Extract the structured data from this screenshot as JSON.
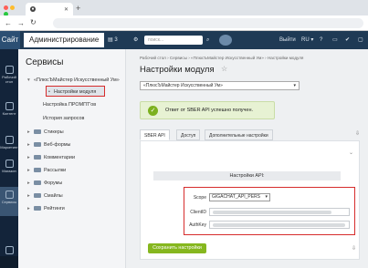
{
  "browser": {
    "tab_title": "",
    "traffic_colors": [
      "#ff5f57",
      "#febc2e",
      "#28c840"
    ]
  },
  "topbar": {
    "site_label": "Сайт",
    "admin_label": "Администрирование",
    "notifications_count": "3",
    "search_placeholder": "поиск...",
    "logout_label": "Выйти",
    "lang_label": "RU"
  },
  "leftbar": [
    {
      "label": "Рабочий стол",
      "icon": "desktop-icon"
    },
    {
      "label": "Контент",
      "icon": "content-icon"
    },
    {
      "label": "Маркетинг",
      "icon": "marketing-icon"
    },
    {
      "label": "Магазин",
      "icon": "shop-icon"
    },
    {
      "label": "Сервисы",
      "icon": "services-icon"
    },
    {
      "label": "Marketplace",
      "icon": "marketplace-icon"
    }
  ],
  "sidebar": {
    "title": "Сервисы",
    "module": "«ПлюсЪМайстер Искусственный Ум»",
    "subitems": [
      "Настройки модуля",
      "Настройка ПРОМПТ'ов",
      "История запросов"
    ],
    "items": [
      "Стикеры",
      "Веб-формы",
      "Комментарии",
      "Рассылки",
      "Форумы",
      "Смайлы",
      "Рейтинги"
    ]
  },
  "main": {
    "breadcrumbs": "Рабочий стол  ›  Сервисы  ›  «ПлюсЪМайстер Искусственный Ум»  ›  Настройки модуля",
    "title": "Настройки модуля",
    "module_select": "«ПлюсЪМайстер Искусственный Ум»",
    "notice": "Ответ от SBER API успешно получен.",
    "tabs": [
      "SBER API",
      "Доступ",
      "Дополнительные настройки"
    ],
    "section_title": "Настройки API:",
    "fields": {
      "scope_label": "Scope",
      "scope_value": "GIGACHAT_API_PERS",
      "client_id_label": "ClientID",
      "auth_key_label": "AuthKey"
    },
    "save_label": "Сохранить настройки"
  },
  "colors": {
    "accent_green": "#86b71f",
    "highlight_red": "#d62c2c",
    "nav_dark": "#1f3a55"
  }
}
